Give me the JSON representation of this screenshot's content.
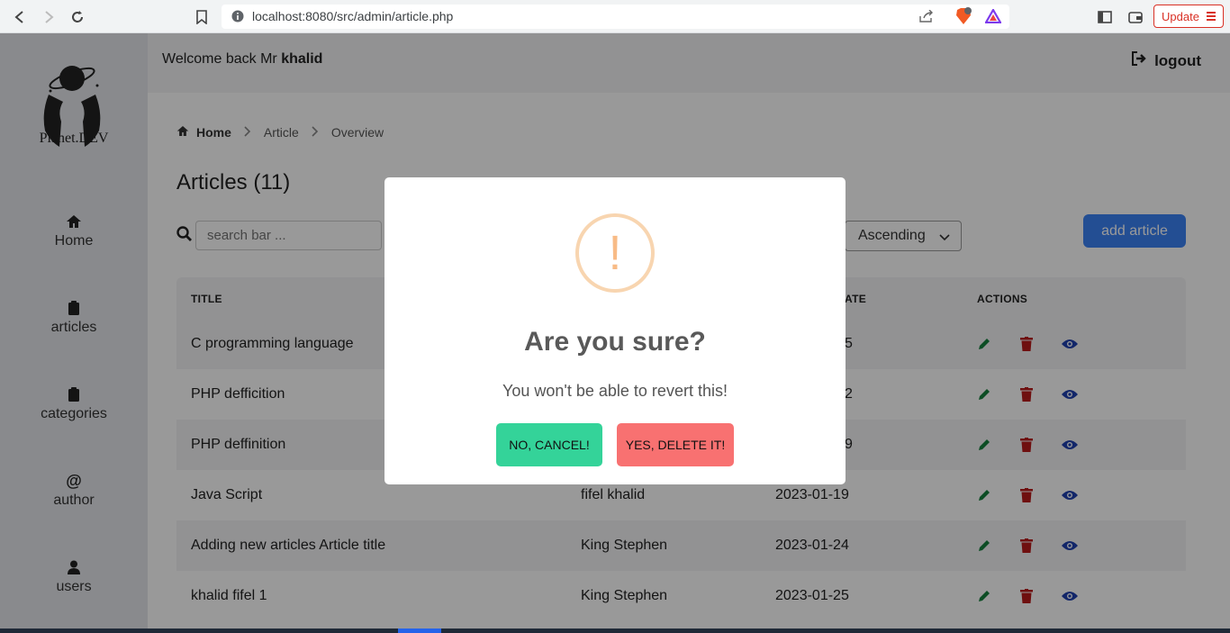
{
  "browser": {
    "url": "localhost:8080/src/admin/article.php",
    "update_label": "Update"
  },
  "sidebar": {
    "logo_text": "Planet.DEV",
    "items": [
      {
        "label": "Home",
        "icon": "home-icon"
      },
      {
        "label": "articles",
        "icon": "clipboard-icon"
      },
      {
        "label": "categories",
        "icon": "clipboard-icon"
      },
      {
        "label": "author",
        "icon": "at-icon"
      },
      {
        "label": "users",
        "icon": "user-icon"
      }
    ]
  },
  "header": {
    "welcome_prefix": "Welcome back Mr",
    "username": "khalid",
    "logout_label": "logout"
  },
  "breadcrumb": {
    "home": "Home",
    "article": "Article",
    "overview": "Overview"
  },
  "main": {
    "title": "Articles (11)",
    "search_placeholder": "search bar ...",
    "sort_value": "Ascending",
    "add_label": "add article"
  },
  "table": {
    "headers": {
      "title": "TITLE",
      "date": "ATE",
      "actions": "ACTIONS"
    },
    "rows": [
      {
        "title": "C programming language",
        "author": "",
        "date": "5"
      },
      {
        "title": "PHP defficition",
        "author": "",
        "date": "2"
      },
      {
        "title": "PHP deffinition",
        "author": "",
        "date": "9"
      },
      {
        "title": "Java Script",
        "author": "fifel khalid",
        "date": "2023-01-19"
      },
      {
        "title": "Adding new articles Article title",
        "author": "King Stephen",
        "date": "2023-01-24"
      },
      {
        "title": "khalid fifel 1",
        "author": "King Stephen",
        "date": "2023-01-25"
      }
    ]
  },
  "modal": {
    "icon_symbol": "!",
    "title": "Are you sure?",
    "text": "You won't be able to revert this!",
    "cancel_label": "NO, CANCEL!",
    "confirm_label": "YES, DELETE IT!"
  },
  "colors": {
    "edit": "#15803d",
    "delete": "#b91c1c",
    "view": "#1e40af",
    "cancel_button": "#34d399",
    "delete_button": "#f87171",
    "add_button": "#3b82f6"
  }
}
